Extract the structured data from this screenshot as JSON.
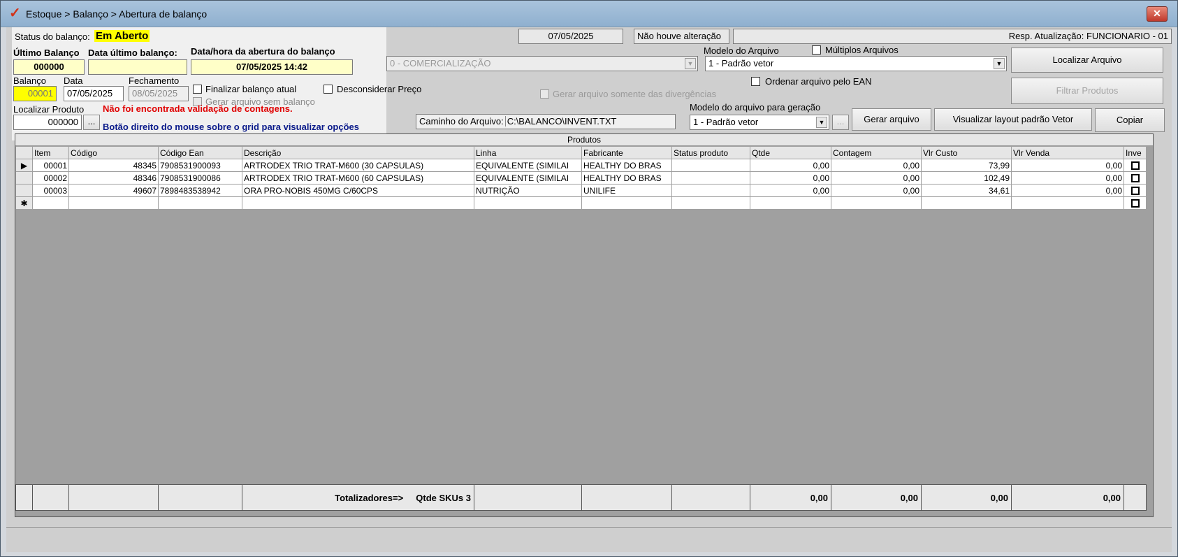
{
  "window": {
    "title": "Estoque > Balanço > Abertura de balanço",
    "close_glyph": "✕",
    "logo_glyph": "✓"
  },
  "status": {
    "label": "Status do balanço:",
    "value": "Em Aberto"
  },
  "ultimo": {
    "label": "Último Balanço",
    "value": "000000"
  },
  "data_ultimo": {
    "label": "Data último balanço:",
    "value": ""
  },
  "abertura": {
    "label": "Data/hora da abertura do balanço",
    "value": "07/05/2025 14:42"
  },
  "balanco": {
    "label": "Balanço",
    "value": "00001"
  },
  "data": {
    "label": "Data",
    "value": "07/05/2025"
  },
  "fechamento": {
    "label": "Fechamento",
    "value": "08/05/2025"
  },
  "checks": {
    "finalizar": "Finalizar balanço atual",
    "gerar_sem": "Gerar arquivo sem balanço",
    "desconsiderar": "Desconsiderar Preço",
    "multiplos": "Múltiplos Arquivos",
    "ordenar_ean": "Ordenar arquivo pelo EAN",
    "somente_div": "Gerar arquivo somente das divergências"
  },
  "localizar": {
    "label": "Localizar Produto",
    "value": "000000",
    "ellipsis": "..."
  },
  "msg_red": "Não foi encontrada validação de contagens.",
  "msg_blue": "Botão direito do mouse sobre o grid para visualizar opções",
  "top_info": {
    "date": "07/05/2025",
    "alteracao": "Não houve alteração",
    "resp": "Resp. Atualização: FUNCIONARIO - 01"
  },
  "comercializacao": {
    "value": "0 - COMERCIALIZAÇÃO"
  },
  "modelo": {
    "label": "Modelo do Arquivo",
    "value": "1 - Padrão vetor"
  },
  "caminho": {
    "label": "Caminho do Arquivo:",
    "value": "C:\\BALANCO\\INVENT.TXT"
  },
  "modelo_ger": {
    "label": "Modelo do arquivo para geração",
    "value": "1 - Padrão vetor"
  },
  "buttons": {
    "localizar_arquivo": "Localizar Arquivo",
    "filtrar": "Filtrar Produtos",
    "gerar": "Gerar arquivo",
    "visualizar": "Visualizar layout padrão Vetor",
    "copiar": "Copiar",
    "ellipsis": "..."
  },
  "grid": {
    "caption": "Produtos",
    "columns": [
      "Item",
      "Código",
      "Código Ean",
      "Descrição",
      "Linha",
      "Fabricante",
      "Status produto",
      "Qtde",
      "Contagem",
      "Vlr Custo",
      "Vlr Venda",
      "Inve"
    ],
    "rows": [
      [
        "00001",
        "48345",
        "7908531900093",
        "ARTRODEX TRIO TRAT-M600 (30 CAPSULAS)",
        "EQUIVALENTE (SIMILAI",
        "HEALTHY DO BRAS",
        "",
        "0,00",
        "0,00",
        "73,99",
        "0,00"
      ],
      [
        "00002",
        "48346",
        "7908531900086",
        "ARTRODEX TRIO TRAT-M600 (60 CAPSULAS)",
        "EQUIVALENTE (SIMILAI",
        "HEALTHY DO BRAS",
        "",
        "0,00",
        "0,00",
        "102,49",
        "0,00"
      ],
      [
        "00003",
        "49607",
        "7898483538942",
        "ORA PRO-NOBIS 450MG C/60CPS",
        "NUTRIÇÃO",
        "UNILIFE",
        "",
        "0,00",
        "0,00",
        "34,61",
        "0,00"
      ]
    ],
    "current_marker": "▶",
    "new_marker": "✱"
  },
  "totals": {
    "label": "Totalizadores=>",
    "skus": "Qtde SKUs 3",
    "qtde": "0,00",
    "contagem": "0,00",
    "custo": "0,00",
    "venda": "0,00"
  }
}
